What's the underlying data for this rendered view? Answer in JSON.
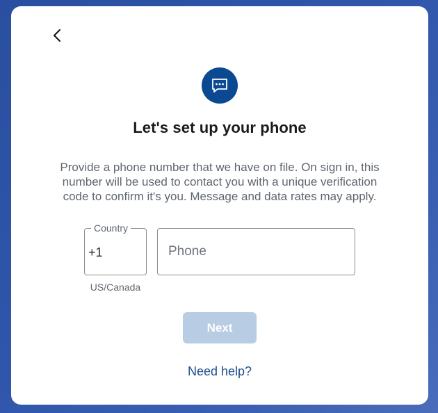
{
  "header": {
    "back_icon": "chevron-left-icon"
  },
  "badge": {
    "icon": "chat-message-icon",
    "color": "#0b4a92"
  },
  "title": "Let's set up your phone",
  "description": "Provide a phone number that we have on file. On sign in, this number will be used to contact you with a unique verification code to confirm it's you. Message and data rates may apply.",
  "country": {
    "label": "Country",
    "value": "+1",
    "hint": "US/Canada"
  },
  "phone": {
    "placeholder": "Phone",
    "value": ""
  },
  "next_button": {
    "label": "Next",
    "state": "disabled",
    "color": "#b8cce4"
  },
  "help_link": "Need help?"
}
